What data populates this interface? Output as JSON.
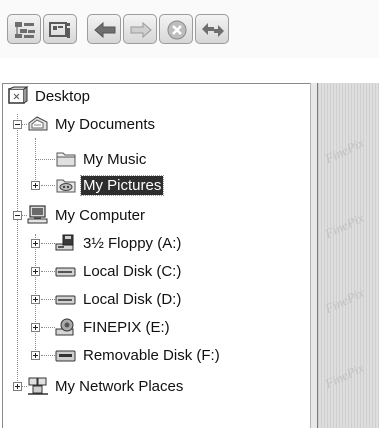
{
  "toolbar": {
    "buttons": [
      {
        "icon": "folder-tree-icon"
      },
      {
        "icon": "properties-icon"
      },
      {
        "icon": "back-arrow-icon"
      },
      {
        "icon": "forward-arrow-icon"
      },
      {
        "icon": "stop-icon"
      },
      {
        "icon": "refresh-icon"
      }
    ]
  },
  "tree": {
    "root": {
      "label": "Desktop",
      "icon": "desktop-icon"
    },
    "my_documents": {
      "label": "My Documents",
      "icon": "my-documents-icon"
    },
    "my_music": {
      "label": "My Music",
      "icon": "folder-icon"
    },
    "my_pictures": {
      "label": "My Pictures",
      "icon": "pictures-folder-icon",
      "selected": true
    },
    "my_computer": {
      "label": "My Computer",
      "icon": "computer-icon"
    },
    "floppy": {
      "label": "3½ Floppy (A:)",
      "icon": "floppy-drive-icon"
    },
    "local_c": {
      "label": "Local Disk (C:)",
      "icon": "hard-disk-icon"
    },
    "local_d": {
      "label": "Local Disk (D:)",
      "icon": "hard-disk-icon"
    },
    "finepix": {
      "label": "FINEPIX (E:)",
      "icon": "camera-drive-icon"
    },
    "removable": {
      "label": "Removable Disk (F:)",
      "icon": "removable-disk-icon"
    },
    "network": {
      "label": "My Network Places",
      "icon": "network-places-icon"
    }
  },
  "preview": {
    "watermark": "FinePix"
  }
}
